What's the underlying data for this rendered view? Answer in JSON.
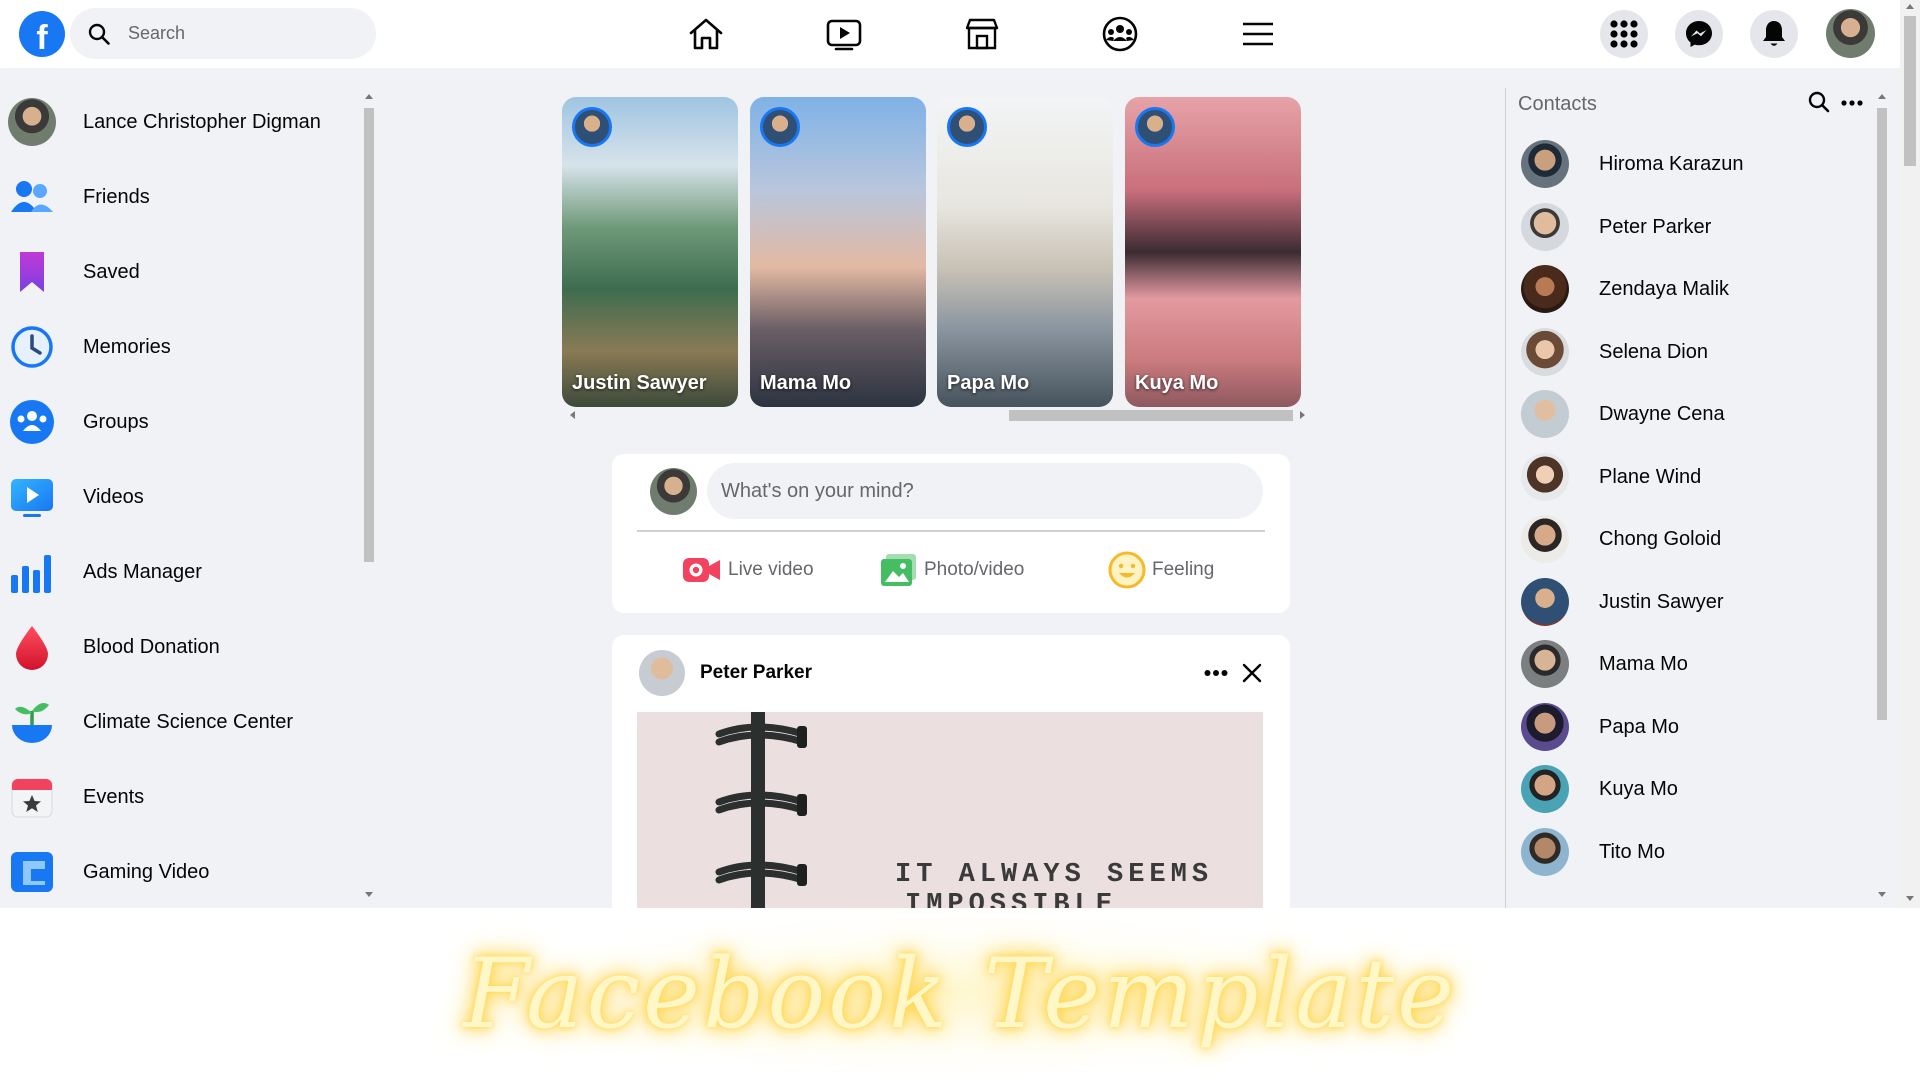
{
  "header": {
    "search_placeholder": "Search",
    "icons": [
      "facebook-logo-icon",
      "search-icon",
      "home-icon",
      "watch-icon",
      "marketplace-icon",
      "groups-icon",
      "menu-icon",
      "apps-grid-icon",
      "messenger-icon",
      "notifications-icon"
    ]
  },
  "sidebar": {
    "items": [
      {
        "label": "Lance Christopher Digman",
        "icon": "profile-avatar"
      },
      {
        "label": "Friends",
        "icon": "friends-icon"
      },
      {
        "label": "Saved",
        "icon": "saved-icon"
      },
      {
        "label": "Memories",
        "icon": "memories-icon"
      },
      {
        "label": "Groups",
        "icon": "groups-icon"
      },
      {
        "label": "Videos",
        "icon": "videos-icon"
      },
      {
        "label": "Ads Manager",
        "icon": "ads-manager-icon"
      },
      {
        "label": "Blood Donation",
        "icon": "blood-donation-icon"
      },
      {
        "label": "Climate Science Center",
        "icon": "climate-icon"
      },
      {
        "label": "Events",
        "icon": "events-icon"
      },
      {
        "label": "Gaming Video",
        "icon": "gaming-icon"
      }
    ]
  },
  "stories": [
    {
      "name": "Justin Sawyer"
    },
    {
      "name": "Mama Mo"
    },
    {
      "name": "Papa Mo"
    },
    {
      "name": "Kuya Mo"
    }
  ],
  "composer": {
    "placeholder": "What's on your mind?",
    "actions": [
      {
        "label": "Live video",
        "icon": "live-video-icon",
        "color": "#f3425f"
      },
      {
        "label": "Photo/video",
        "icon": "photo-icon",
        "color": "#45bd62"
      },
      {
        "label": "Feeling",
        "icon": "feeling-icon",
        "color": "#f7b928"
      }
    ]
  },
  "post": {
    "author": "Peter Parker",
    "image_text_line1": "IT ALWAYS SEEMS",
    "image_text_line2": "IMPOSSIBLE"
  },
  "contacts": {
    "title": "Contacts",
    "items": [
      {
        "name": "Hiroma Karazun"
      },
      {
        "name": "Peter Parker"
      },
      {
        "name": "Zendaya Malik"
      },
      {
        "name": "Selena Dion"
      },
      {
        "name": "Dwayne Cena"
      },
      {
        "name": "Plane Wind"
      },
      {
        "name": "Chong Goloid"
      },
      {
        "name": "Justin Sawyer"
      },
      {
        "name": "Mama Mo"
      },
      {
        "name": "Papa Mo"
      },
      {
        "name": "Kuya Mo"
      },
      {
        "name": "Tito Mo"
      }
    ]
  },
  "banner": {
    "text": "Facebook Template"
  },
  "colors": {
    "brand": "#1877f2",
    "background": "#f0f2f5",
    "banner_glow": "#ffd84d"
  }
}
